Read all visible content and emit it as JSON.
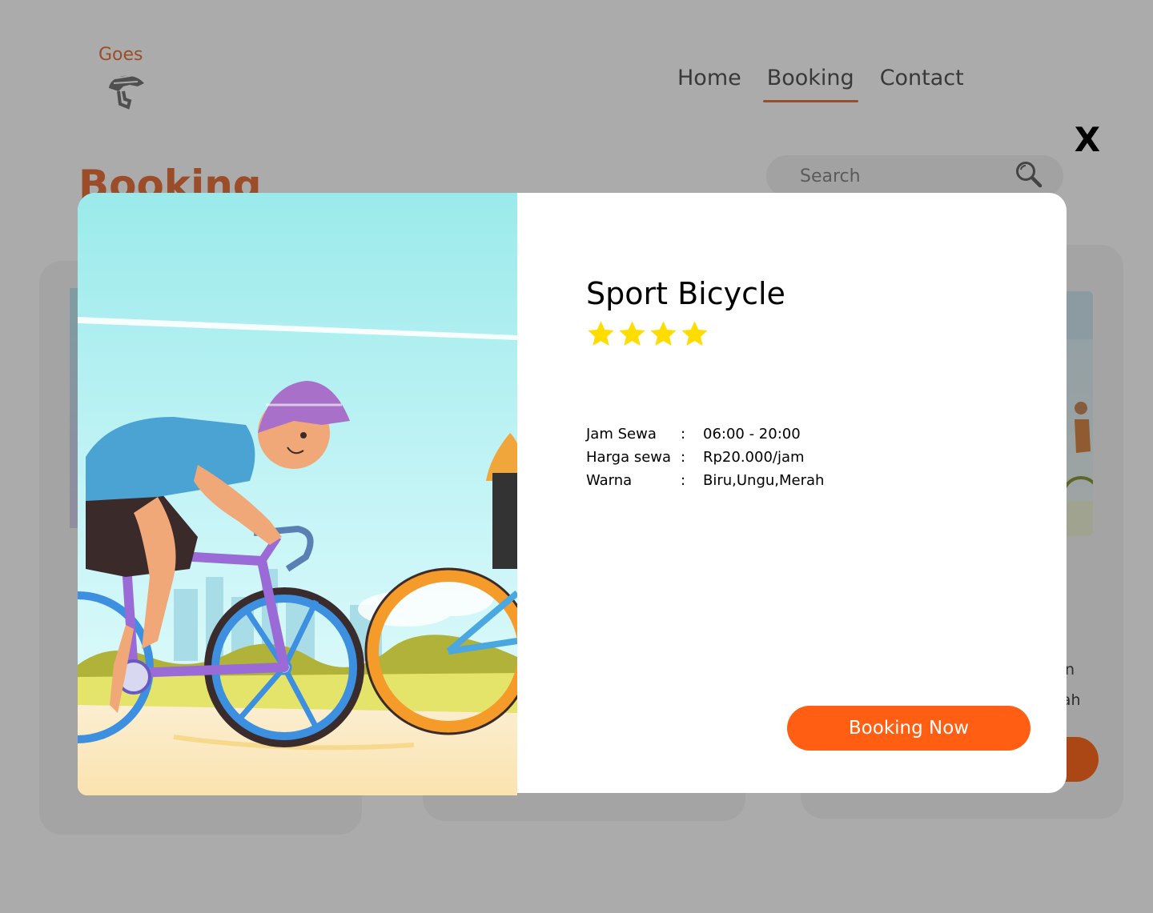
{
  "brand": {
    "name": "Goes",
    "logo_icon": "bike-helmet-icon",
    "color": "#e8743f"
  },
  "nav": {
    "items": [
      {
        "label": "Home",
        "active": false
      },
      {
        "label": "Booking",
        "active": true
      },
      {
        "label": "Contact",
        "active": false
      }
    ]
  },
  "page": {
    "heading": "Booking"
  },
  "search": {
    "placeholder": "Search",
    "icon": "search-icon"
  },
  "background_cards": {
    "card_3_fragments": [
      "n",
      "rah"
    ]
  },
  "modal": {
    "close_label": "X",
    "image": {
      "icon": "cyclist-illustration"
    },
    "title": "Sport Bicycle",
    "rating": {
      "value": 4,
      "max": 4,
      "icon": "star-icon",
      "color": "#ffdd00"
    },
    "specs": [
      {
        "label": "Jam Sewa",
        "separator": ":",
        "value": "06:00 - 20:00"
      },
      {
        "label": "Harga sewa",
        "separator": ":",
        "value": "Rp20.000/jam"
      },
      {
        "label": "Warna",
        "separator": ":",
        "value": "Biru,Ungu,Merah"
      }
    ],
    "cta_label": "Booking Now",
    "cta_color": "#ff5e13"
  },
  "colors": {
    "accent": "#e8743f",
    "overlay": "rgba(0,0,0,0.33)"
  }
}
